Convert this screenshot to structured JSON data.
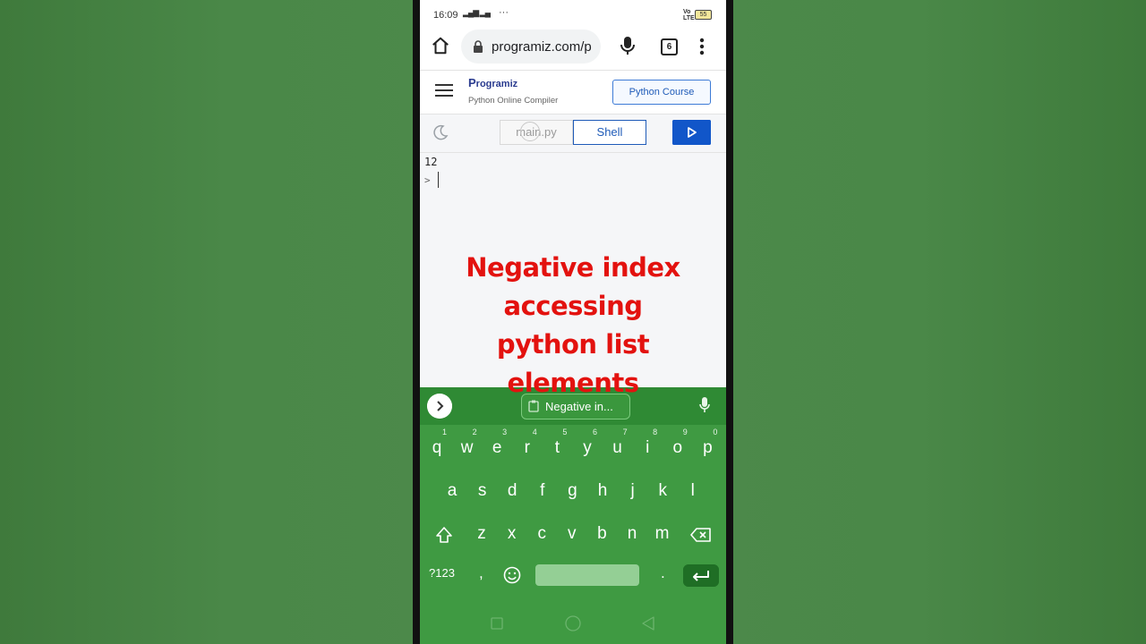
{
  "status_bar": {
    "time": "16:09",
    "signal_text": "⁴ᴳ▎▐▌",
    "more": "···",
    "volte": "VoLTE",
    "battery": "55"
  },
  "browser": {
    "url": "programiz.com/p",
    "tab_count": "6"
  },
  "site": {
    "logo_p": "P",
    "logo_rest": "rogramiz",
    "subtitle": "Python Online Compiler",
    "course_button": "Python Course"
  },
  "editor": {
    "tab_main": "main.py",
    "tab_shell": "Shell"
  },
  "shell": {
    "output": "12",
    "prompt": ">"
  },
  "overlay": {
    "line1": "Negative index",
    "line2": "accessing",
    "line3": "python list",
    "line4": "elements"
  },
  "keyboard": {
    "clipboard_suggestion": "Negative in...",
    "row1": [
      "q",
      "w",
      "e",
      "r",
      "t",
      "y",
      "u",
      "i",
      "o",
      "p"
    ],
    "row1_hints": [
      "1",
      "2",
      "3",
      "4",
      "5",
      "6",
      "7",
      "8",
      "9",
      "0"
    ],
    "row2": [
      "a",
      "s",
      "d",
      "f",
      "g",
      "h",
      "j",
      "k",
      "l"
    ],
    "row3": [
      "z",
      "x",
      "c",
      "v",
      "b",
      "n",
      "m"
    ],
    "symbols_key": "?123",
    "comma_key": ",",
    "period_key": "."
  },
  "colors": {
    "keyboard_bg": "#3f9a42",
    "overlay_text": "#e3120f",
    "accent_blue": "#1156c9"
  }
}
